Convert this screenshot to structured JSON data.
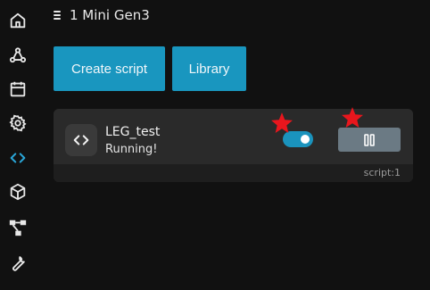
{
  "header": {
    "title": "1 Mini Gen3"
  },
  "sidebar": {
    "items": [
      {
        "icon": "home-icon",
        "active": false
      },
      {
        "icon": "webhook-icon",
        "active": false
      },
      {
        "icon": "calendar-icon",
        "active": false
      },
      {
        "icon": "gear-icon",
        "active": false
      },
      {
        "icon": "code-icon",
        "active": true
      },
      {
        "icon": "codesandbox-icon",
        "active": false
      },
      {
        "icon": "flow-icon",
        "active": false
      },
      {
        "icon": "wrench-icon",
        "active": false
      }
    ]
  },
  "actions": {
    "create_label": "Create script",
    "library_label": "Library"
  },
  "script_card": {
    "name": "LEG_test",
    "status": "Running!",
    "tag": "script:1",
    "enabled": true
  },
  "colors": {
    "accent": "#1996bf",
    "active_icon": "#2aa6d8",
    "pause_button": "#6b7a84",
    "annotation": "#e8161d"
  }
}
